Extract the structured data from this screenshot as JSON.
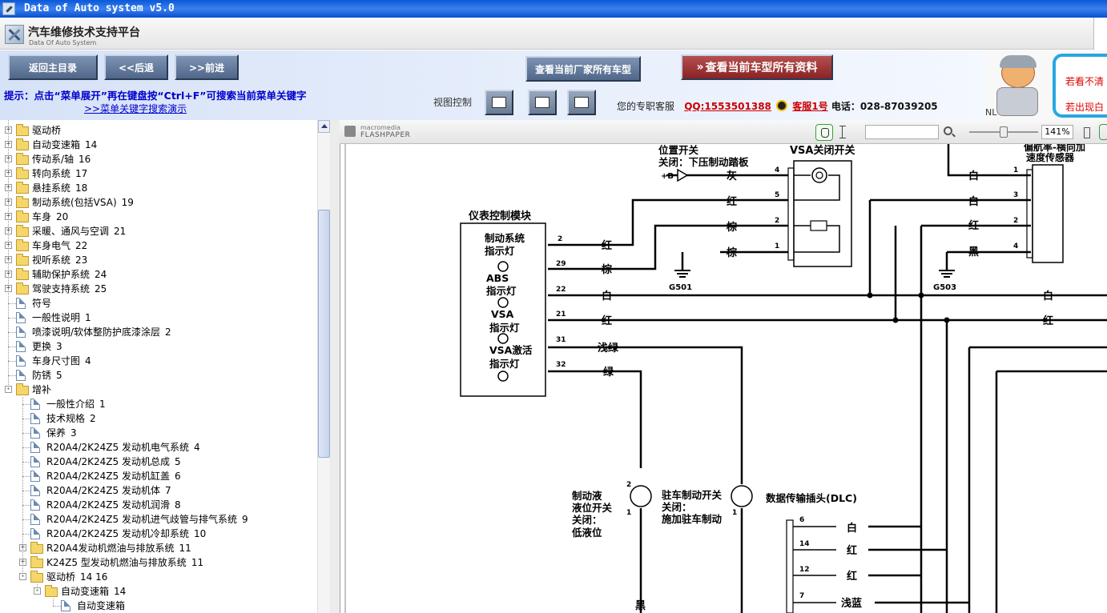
{
  "window": {
    "title": "Data of Auto system v5.0"
  },
  "brand": {
    "title": "汽车维修技术支持平台",
    "subtitle": "Data Of Auto System"
  },
  "nav": {
    "back_home": "返回主目录",
    "back": "<<后退",
    "forward": ">>前进",
    "all_models": "查看当前厂家所有车型",
    "all_docs": "查看当前车型所有资料"
  },
  "hint": {
    "text": "提示：点击“菜单展开”再在键盘按“Ctrl+F”可搜索当前菜单关键字",
    "link": ">>菜单关键字搜索演示"
  },
  "view_control": {
    "label": "视图控制"
  },
  "service": {
    "label": "您的专职客服",
    "qq": "QQ:1553501388",
    "kf": "客服1号",
    "phone": "电话：028-87039205"
  },
  "ad": {
    "line1": "若看不清",
    "line2": "若出现白",
    "nl": "NL"
  },
  "tree": [
    {
      "label": "驱动桥",
      "num": "",
      "type": "folder",
      "level": 0,
      "expander": "+"
    },
    {
      "label": "自动变速箱",
      "num": "14",
      "type": "folder",
      "level": 0,
      "expander": "+"
    },
    {
      "label": "传动系/轴",
      "num": "16",
      "type": "folder",
      "level": 0,
      "expander": "+"
    },
    {
      "label": "转向系统",
      "num": "17",
      "type": "folder",
      "level": 0,
      "expander": "+"
    },
    {
      "label": "悬挂系统",
      "num": "18",
      "type": "folder",
      "level": 0,
      "expander": "+"
    },
    {
      "label": "制动系统(包括VSA)",
      "num": "19",
      "type": "folder",
      "level": 0,
      "expander": "+"
    },
    {
      "label": "车身",
      "num": "20",
      "type": "folder",
      "level": 0,
      "expander": "+"
    },
    {
      "label": "采暖、通风与空调",
      "num": "21",
      "type": "folder",
      "level": 0,
      "expander": "+"
    },
    {
      "label": "车身电气",
      "num": "22",
      "type": "folder",
      "level": 0,
      "expander": "+"
    },
    {
      "label": "视听系统",
      "num": "23",
      "type": "folder",
      "level": 0,
      "expander": "+"
    },
    {
      "label": "辅助保护系统",
      "num": "24",
      "type": "folder",
      "level": 0,
      "expander": "+"
    },
    {
      "label": "驾驶支持系统",
      "num": "25",
      "type": "folder",
      "level": 0,
      "expander": "+"
    },
    {
      "label": "符号",
      "num": "",
      "type": "doc",
      "level": 0,
      "expander": ""
    },
    {
      "label": "一般性说明",
      "num": "1",
      "type": "doc",
      "level": 0,
      "expander": ""
    },
    {
      "label": "喷漆说明/软体整防护底漆涂层",
      "num": "2",
      "type": "doc",
      "level": 0,
      "expander": ""
    },
    {
      "label": "更换",
      "num": "3",
      "type": "doc",
      "level": 0,
      "expander": ""
    },
    {
      "label": "车身尺寸图",
      "num": "4",
      "type": "doc",
      "level": 0,
      "expander": ""
    },
    {
      "label": "防锈",
      "num": "5",
      "type": "doc",
      "level": 0,
      "expander": ""
    },
    {
      "label": "增补",
      "num": "",
      "type": "folder",
      "level": 0,
      "expander": "-"
    },
    {
      "label": "一般性介绍",
      "num": "1",
      "type": "doc",
      "level": 1,
      "expander": ""
    },
    {
      "label": "技术规格",
      "num": "2",
      "type": "doc",
      "level": 1,
      "expander": ""
    },
    {
      "label": "保养",
      "num": "3",
      "type": "doc",
      "level": 1,
      "expander": ""
    },
    {
      "label": "R20A4/2K24Z5 发动机电气系统",
      "num": "4",
      "type": "doc",
      "level": 1,
      "expander": ""
    },
    {
      "label": "R20A4/2K24Z5 发动机总成",
      "num": "5",
      "type": "doc",
      "level": 1,
      "expander": ""
    },
    {
      "label": "R20A4/2K24Z5 发动机缸盖",
      "num": "6",
      "type": "doc",
      "level": 1,
      "expander": ""
    },
    {
      "label": "R20A4/2K24Z5 发动机体",
      "num": "7",
      "type": "doc",
      "level": 1,
      "expander": ""
    },
    {
      "label": "R20A4/2K24Z5 发动机润滑",
      "num": "8",
      "type": "doc",
      "level": 1,
      "expander": ""
    },
    {
      "label": "R20A4/2K24Z5 发动机进气歧管与排气系统",
      "num": "9",
      "type": "doc",
      "level": 1,
      "expander": ""
    },
    {
      "label": "R20A4/2K24Z5 发动机冷却系统",
      "num": "10",
      "type": "doc",
      "level": 1,
      "expander": ""
    },
    {
      "label": "R20A4发动机燃油与排放系统",
      "num": "11",
      "type": "folder",
      "level": 1,
      "expander": "+"
    },
    {
      "label": "K24Z5 型发动机燃油与排放系统",
      "num": "11",
      "type": "folder",
      "level": 1,
      "expander": "+"
    },
    {
      "label": "驱动桥",
      "num": "14 16",
      "type": "folder",
      "level": 1,
      "expander": "-"
    },
    {
      "label": "自动变速箱",
      "num": "14",
      "type": "folder",
      "level": 2,
      "expander": "-"
    },
    {
      "label": "自动变速箱",
      "num": "",
      "type": "doc",
      "level": 3,
      "expander": ""
    }
  ],
  "viewer": {
    "brand_top": "macromedia",
    "brand_bottom": "FLASHPAPER",
    "zoom": "141%"
  },
  "diagram": {
    "module_title": "仪表控制模块",
    "mod1a": "制动系统",
    "mod1b": "指示灯",
    "mod2a": "ABS",
    "mod2b": "指示灯",
    "mod3a": "VSA",
    "mod3b": "指示灯",
    "mod4a": "VSA激活",
    "mod4b": "指示灯",
    "pos_sw_a": "位置开关",
    "pos_sw_b": "关闭：下压制动踏板",
    "vsa_off_sw": "VSA关闭开关",
    "yaw_a": "偏航率-横向加",
    "yaw_b": "速度传感器",
    "plus_b": "+B",
    "g501": "G501",
    "g503": "G503",
    "fluid_a": "制动液",
    "fluid_b": "液位开关",
    "fluid_c": "关闭：",
    "fluid_d": "低液位",
    "park_a": "驻车制动开关",
    "park_b": "关闭：",
    "park_c": "施加驻车制动",
    "dlc": "数据传输插头(DLC)",
    "w_hui": "灰",
    "w_hong": "红",
    "w_zong": "棕",
    "w_bai": "白",
    "w_hei": "黑",
    "w_qianlv": "浅绿",
    "w_lv": "绿",
    "w_qianlan": "浅蓝",
    "p2": "2",
    "p29": "29",
    "p22": "22",
    "p21": "21",
    "p31": "31",
    "p32": "32",
    "p4": "4",
    "p5": "5",
    "p1": "1",
    "p3": "3",
    "p6": "6",
    "p14": "14",
    "p12": "12",
    "p7": "7"
  }
}
